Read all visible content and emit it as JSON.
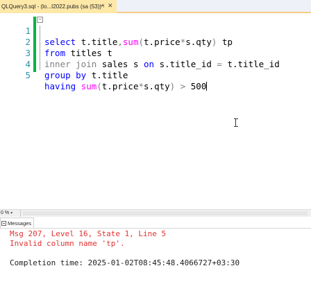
{
  "tab": {
    "title": "QLQuery3.sql - (lo...I2022.pubs (sa (53))*",
    "pin_icon": "pin-icon",
    "close_icon": "close-icon"
  },
  "editor": {
    "lines": [
      {
        "num": "1",
        "tokens": [
          "select",
          "t.title",
          ",",
          "sum",
          "(",
          "t.price",
          "*",
          "s.qty",
          ")",
          "tp"
        ]
      },
      {
        "num": "2",
        "tokens": [
          "from",
          "titles",
          "t"
        ]
      },
      {
        "num": "3",
        "tokens": [
          "inner join",
          "sales",
          "s",
          "on",
          "s.title_id",
          "=",
          "t.title_id"
        ]
      },
      {
        "num": "4",
        "tokens": [
          "group by",
          "t.title"
        ]
      },
      {
        "num": "5",
        "tokens": [
          "having",
          "sum",
          "(",
          "t.price",
          "*",
          "s.qty",
          ")",
          ">",
          "500"
        ]
      }
    ],
    "outline_symbol": "−"
  },
  "footer": {
    "zoom": "0 %"
  },
  "results": {
    "tab_label": "Messages",
    "messages": [
      "Msg 207, Level 16, State 1, Line 5",
      "Invalid column name 'tp'.",
      "",
      "Completion time: 2025-01-02T08:45:48.4066727+03:30"
    ]
  },
  "colors": {
    "keyword": "#0000ff",
    "function": "#ff00ff",
    "operator": "#808080",
    "line_number": "#2b91af",
    "error": "#e13333",
    "tab_active": "#fde8a8",
    "change_bar": "#00b44a"
  }
}
